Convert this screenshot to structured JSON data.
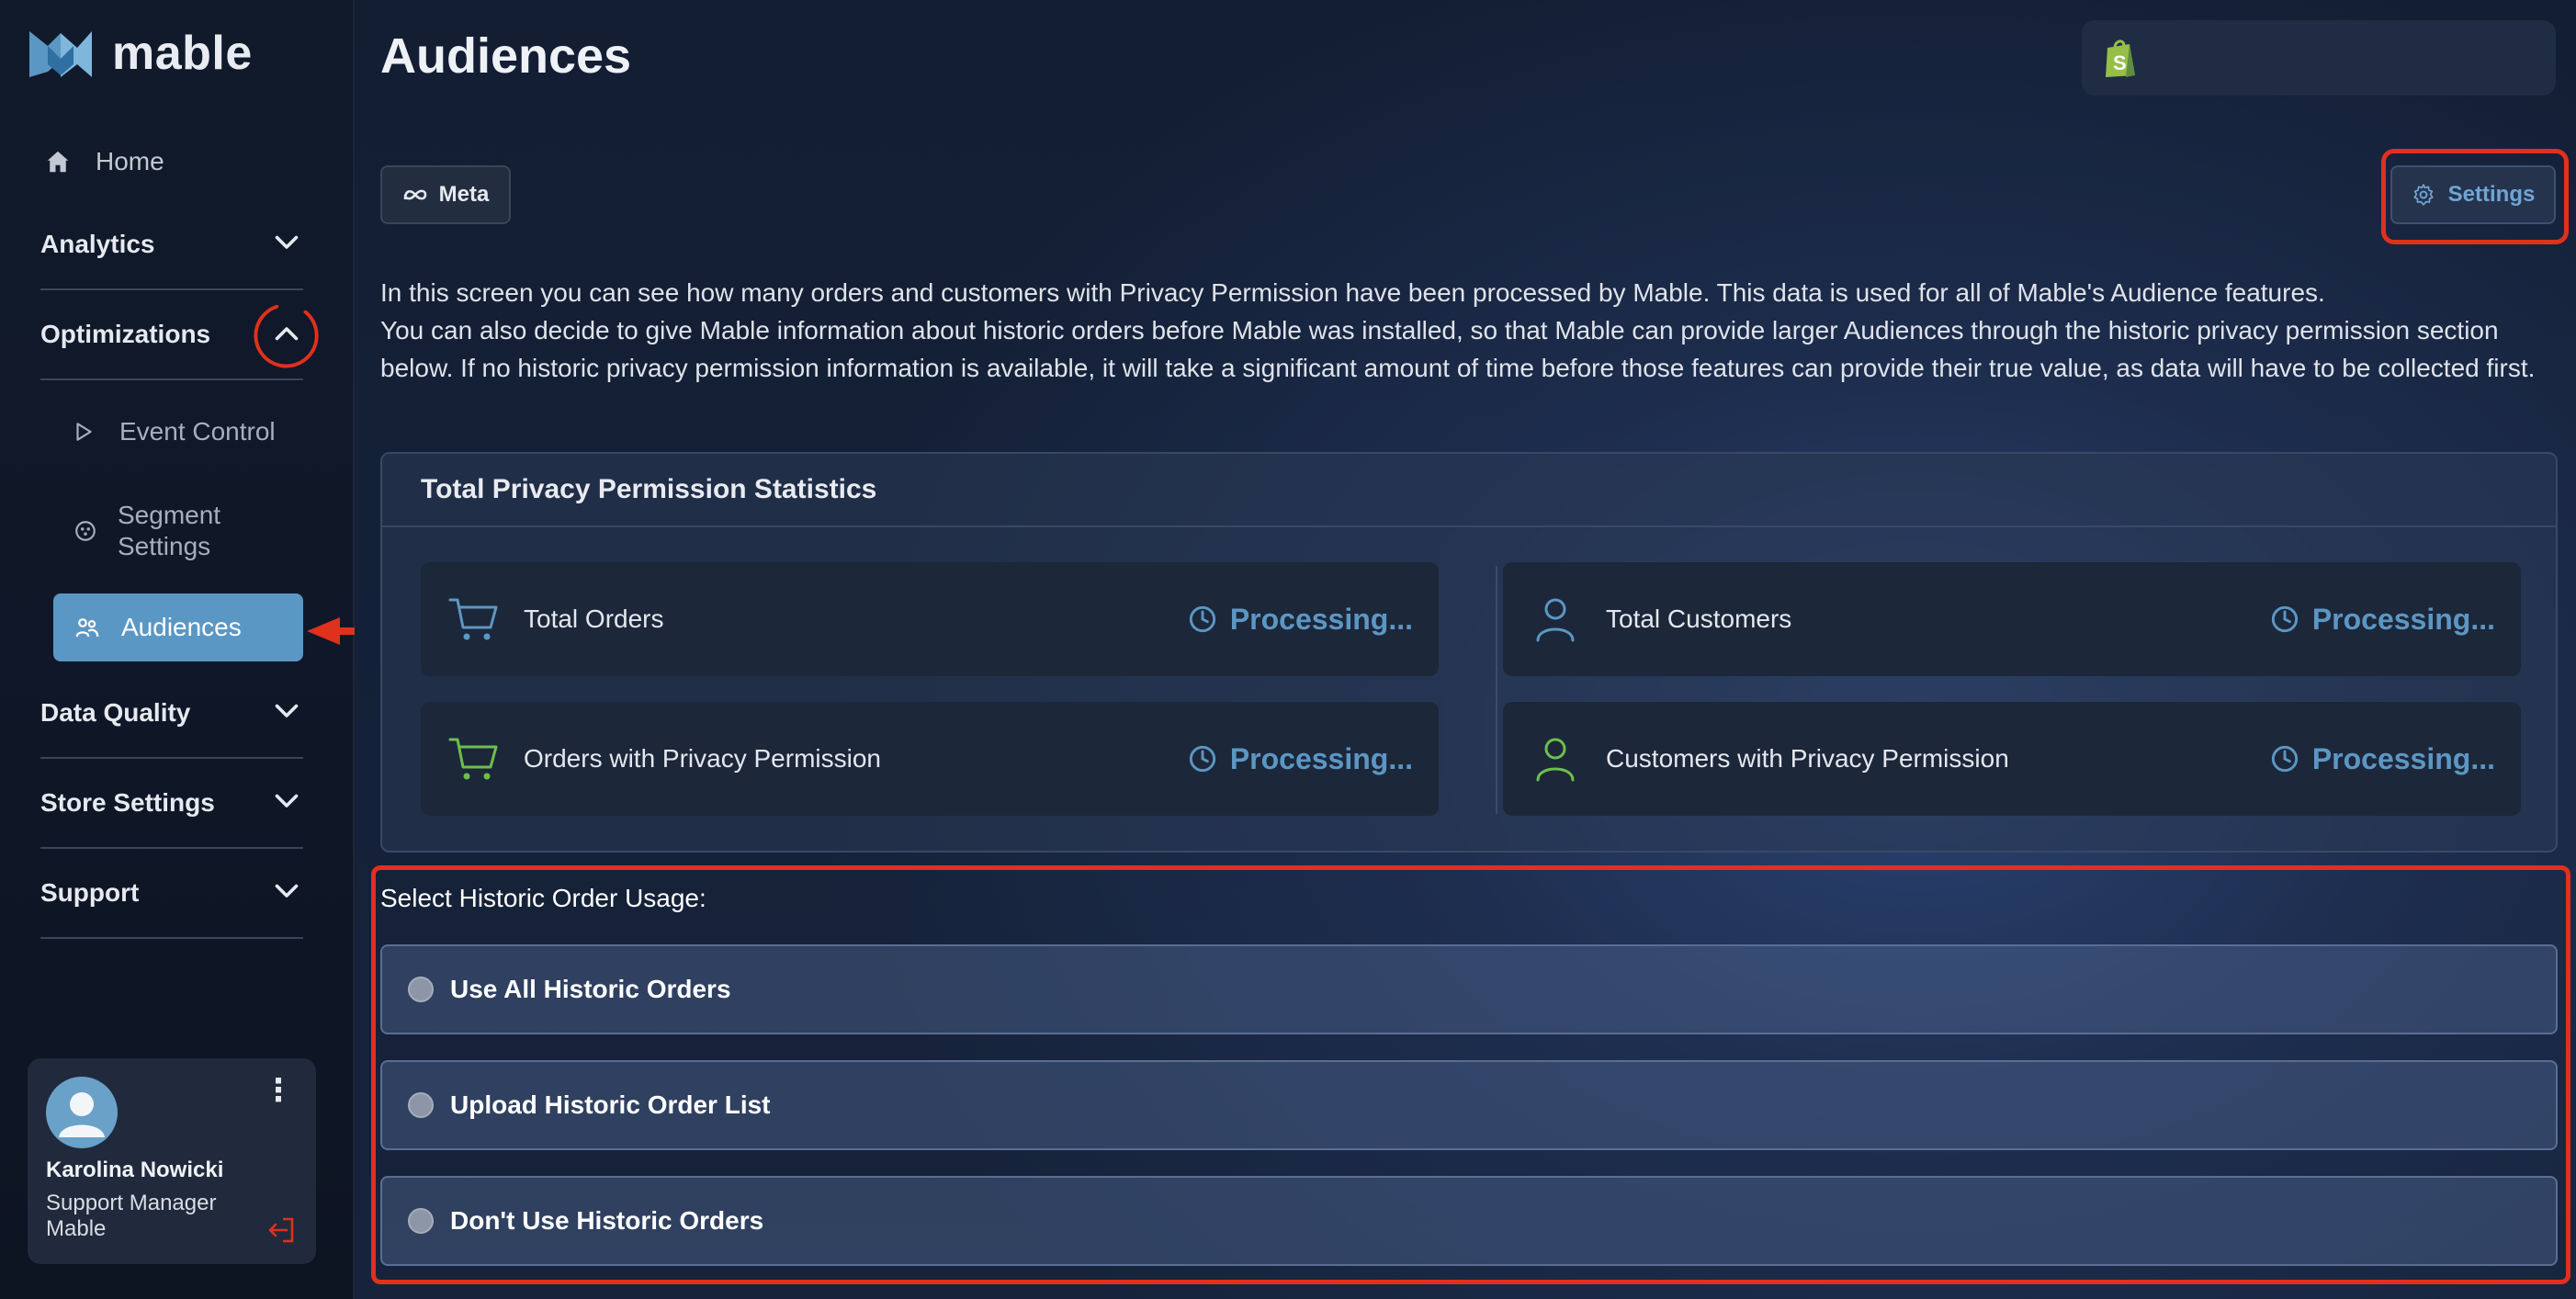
{
  "app": {
    "logo_text": "mable"
  },
  "sidebar": {
    "home": "Home",
    "sections": [
      {
        "label": "Analytics"
      },
      {
        "label": "Optimizations"
      },
      {
        "label": "Data Quality"
      },
      {
        "label": "Store Settings"
      },
      {
        "label": "Support"
      }
    ],
    "sub_items": [
      {
        "label": "Event Control"
      },
      {
        "label": "Segment Settings"
      },
      {
        "label": "Audiences"
      }
    ],
    "user": {
      "name": "Karolina Nowicki",
      "role": "Support Manager",
      "company": "Mable"
    }
  },
  "header": {
    "title": "Audiences"
  },
  "toolbar": {
    "meta_label": "Meta",
    "settings_label": "Settings"
  },
  "intro": {
    "line1": "In this screen you can see how many orders and customers with Privacy Permission have been processed by Mable. This data is used for all of Mable's Audience features.",
    "line2": "You can also decide to give Mable information about historic orders before Mable was installed, so that Mable can provide larger Audiences through the historic privacy permission section below. If no historic privacy permission information is available, it will take a significant amount of time before those features can provide their true value, as data will have to be collected first."
  },
  "stats": {
    "title": "Total Privacy Permission Statistics",
    "cards": [
      {
        "label": "Total Orders",
        "status": "Processing...",
        "icon": "cart-icon",
        "color": "#5b97c4"
      },
      {
        "label": "Total Customers",
        "status": "Processing...",
        "icon": "user-icon",
        "color": "#5b97c4"
      },
      {
        "label": "Orders with Privacy Permission",
        "status": "Processing...",
        "icon": "cart-icon",
        "color": "#6cc04a"
      },
      {
        "label": "Customers with Privacy Permission",
        "status": "Processing...",
        "icon": "user-icon",
        "color": "#6cc04a"
      }
    ]
  },
  "usage": {
    "title": "Select Historic Order Usage:",
    "options": [
      {
        "label": "Use All Historic Orders"
      },
      {
        "label": "Upload Historic Order List"
      },
      {
        "label": "Don't Use Historic Orders"
      }
    ]
  },
  "colors": {
    "accent": "#5b97c4",
    "highlight": "#e0301e",
    "green": "#6cc04a"
  }
}
